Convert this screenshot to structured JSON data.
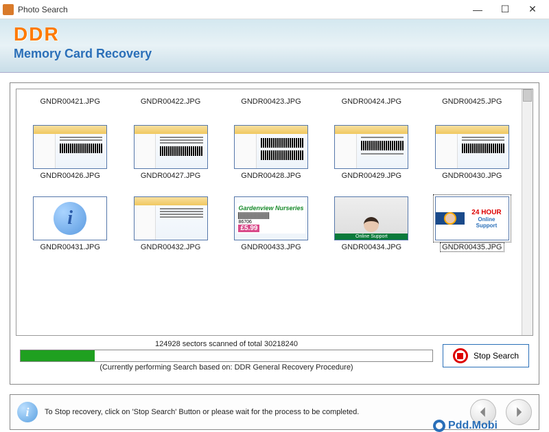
{
  "window": {
    "title": "Photo Search"
  },
  "header": {
    "logo": "DDR",
    "subtitle": "Memory Card Recovery"
  },
  "files": {
    "row1": [
      "GNDR00421.JPG",
      "GNDR00422.JPG",
      "GNDR00423.JPG",
      "GNDR00424.JPG",
      "GNDR00425.JPG"
    ],
    "row2": [
      "GNDR00426.JPG",
      "GNDR00427.JPG",
      "GNDR00428.JPG",
      "GNDR00429.JPG",
      "GNDR00430.JPG"
    ],
    "row3": [
      "GNDR00431.JPG",
      "GNDR00432.JPG",
      "GNDR00433.JPG",
      "GNDR00434.JPG",
      "GNDR00435.JPG"
    ]
  },
  "garden": {
    "title": "Gardenview Nurseries",
    "code": "86706",
    "price": "£5.99"
  },
  "person_band": "Online Support",
  "support": {
    "line1": "24 HOUR",
    "line2": "Online",
    "line3": "Support"
  },
  "progress": {
    "text": "124928 sectors scanned of total 30218240",
    "sub": "(Currently performing Search based on:  DDR General Recovery Procedure)",
    "percent": 18
  },
  "stop_label": "Stop Search",
  "hint": "To Stop recovery, click on 'Stop Search' Button or please wait for the process to be completed.",
  "watermark": "Pdd.Mobi"
}
